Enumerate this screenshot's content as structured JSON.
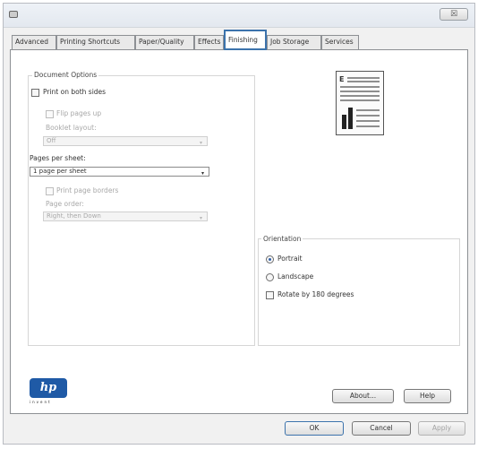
{
  "tabs": [
    {
      "label": "Advanced"
    },
    {
      "label": "Printing Shortcuts"
    },
    {
      "label": "Paper/Quality"
    },
    {
      "label": "Effects"
    },
    {
      "label": "Finishing"
    },
    {
      "label": "Job Storage"
    },
    {
      "label": "Services"
    }
  ],
  "active_tab": "Finishing",
  "title_close": "☒",
  "document_options": {
    "legend": "Document Options",
    "print_both_sides": "Print on both sides",
    "flip_pages_up": "Flip pages up",
    "booklet_layout_label": "Booklet layout:",
    "booklet_layout_value": "Off",
    "pages_per_sheet_label": "Pages per sheet:",
    "pages_per_sheet_value": "1 page per sheet",
    "print_page_borders": "Print page borders",
    "page_order_label": "Page order:",
    "page_order_value": "Right, then Down"
  },
  "orientation": {
    "legend": "Orientation",
    "portrait": "Portrait",
    "landscape": "Landscape",
    "rotate": "Rotate by 180 degrees",
    "selected": "Portrait"
  },
  "logo": {
    "text": "hp",
    "sub": "invent"
  },
  "buttons": {
    "about": "About...",
    "help": "Help",
    "ok": "OK",
    "cancel": "Cancel",
    "apply": "Apply"
  },
  "icons": {
    "arrow": "▾",
    "titlebar_icon": "printer-icon"
  }
}
